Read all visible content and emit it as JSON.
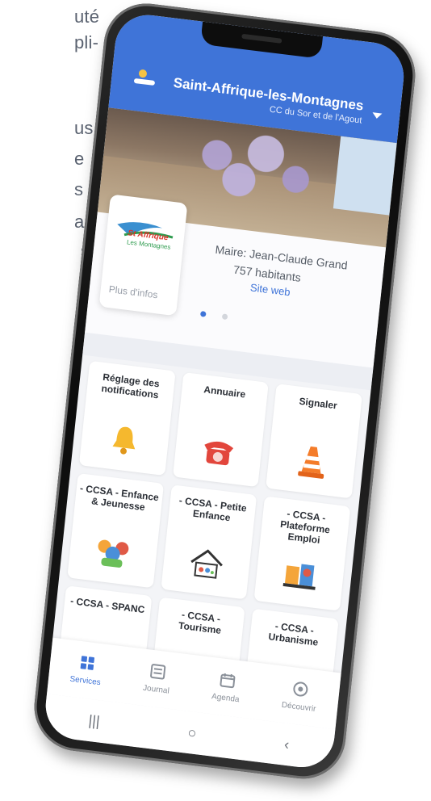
{
  "side_text": {
    "line1": "uté",
    "line2": "pli-",
    "line3": "us",
    "line4": "e",
    "line5": "s",
    "line6": "a",
    "line7": "s"
  },
  "header": {
    "title": "Saint-Affrique-les-Montagnes",
    "subtitle": "CC du Sor et de l'Agout",
    "accent": "#3f74d8"
  },
  "info": {
    "logo_line1": "St Affrique",
    "logo_line2": "Les Montagnes",
    "more_info": "Plus d'infos",
    "mayor": "Maire: Jean-Claude Grand",
    "population": "757 habitants",
    "website": "Site web"
  },
  "services": [
    {
      "label": "Réglage des notifications",
      "icon": "bell-icon"
    },
    {
      "label": "Annuaire",
      "icon": "phone-icon"
    },
    {
      "label": "Signaler",
      "icon": "traffic-cone-icon"
    },
    {
      "label": "- CCSA - Enfance & Jeunesse",
      "icon": "children-icon"
    },
    {
      "label": "- CCSA - Petite Enfance",
      "icon": "house-family-icon"
    },
    {
      "label": "- CCSA - Plateforme Emploi",
      "icon": "job-platform-icon"
    },
    {
      "label": "- CCSA - SPANC",
      "icon": ""
    },
    {
      "label": "- CCSA - Tourisme",
      "icon": ""
    },
    {
      "label": "- CCSA - Urbanisme",
      "icon": ""
    }
  ],
  "nav": {
    "services": "Services",
    "journal": "Journal",
    "agenda": "Agenda",
    "discover": "Découvrir"
  },
  "system_bar": {
    "recent": "|||",
    "home": "○",
    "back": "‹"
  }
}
